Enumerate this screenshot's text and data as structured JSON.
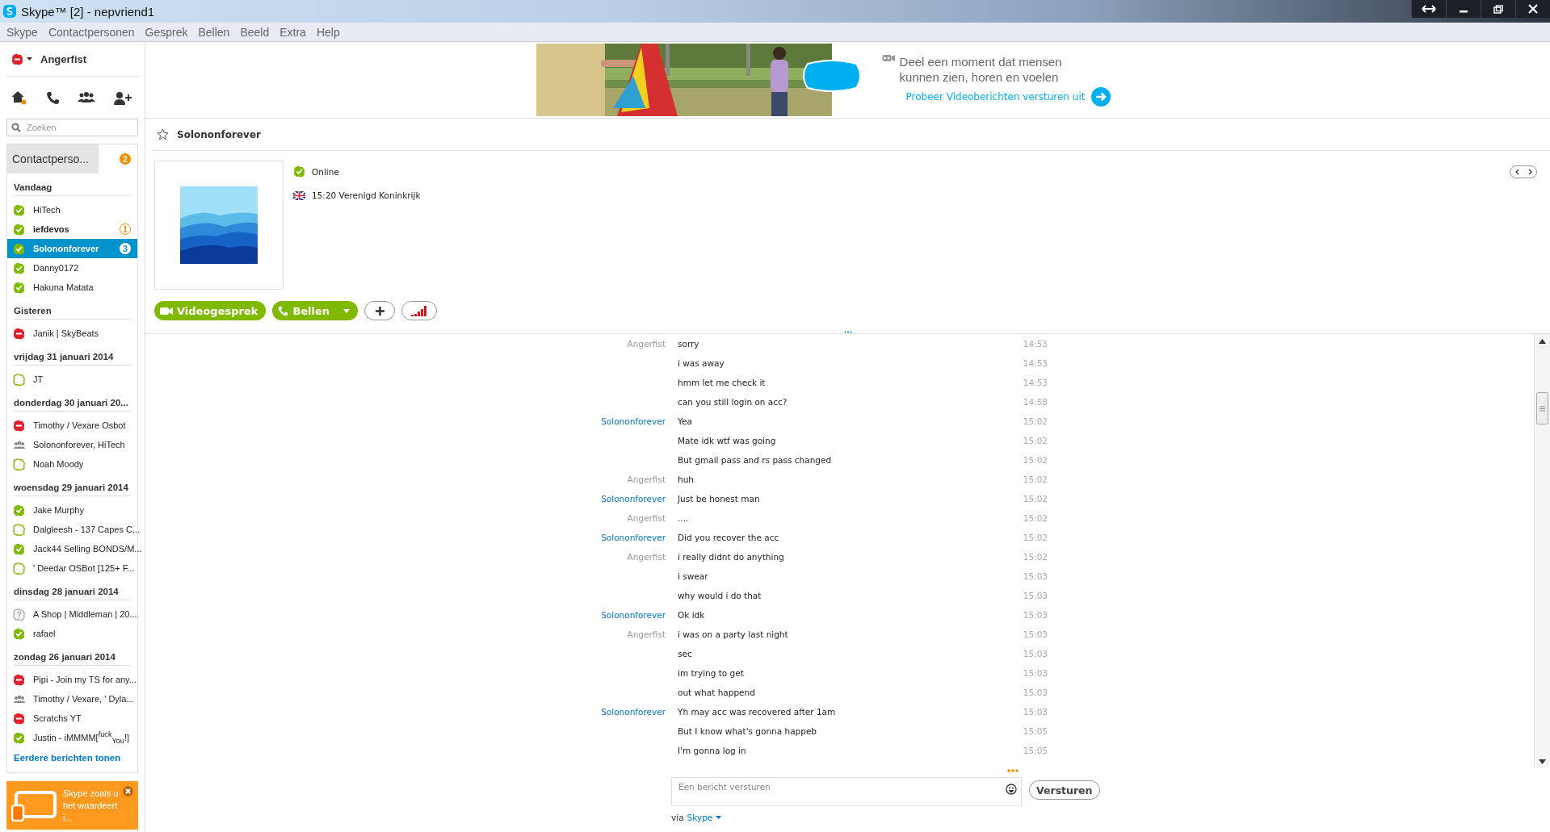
{
  "window": {
    "title": "Skype™ [2] - nepvriend1"
  },
  "menu": [
    "Skype",
    "Contactpersonen",
    "Gesprek",
    "Bellen",
    "Beeld",
    "Extra",
    "Help"
  ],
  "sidebar": {
    "user": {
      "name": "Angerfist",
      "kind": "busy"
    },
    "search": {
      "placeholder": "Zoeken"
    },
    "tab": {
      "label": "Contactperso...",
      "badge": "2"
    },
    "groups": [
      {
        "heading": "Vandaag",
        "contacts": [
          {
            "name": "HiTech",
            "kind": "online",
            "unread": false,
            "selected": false
          },
          {
            "name": "iefdevos",
            "kind": "online",
            "unread": true,
            "selected": false,
            "badge": "1"
          },
          {
            "name": "Solononforever",
            "kind": "online",
            "unread": false,
            "selected": true,
            "badge": "3"
          },
          {
            "name": "Danny0172",
            "kind": "online",
            "unread": false,
            "selected": false
          },
          {
            "name": "Hakuna Matata",
            "kind": "online",
            "unread": false,
            "selected": false
          }
        ]
      },
      {
        "heading": "Gisteren",
        "contacts": [
          {
            "name": "Janik | SkyBeats",
            "kind": "busy",
            "unread": false,
            "selected": false
          }
        ]
      },
      {
        "heading": "vrijdag 31 januari 2014",
        "contacts": [
          {
            "name": "JT",
            "kind": "offline",
            "unread": false,
            "selected": false
          }
        ]
      },
      {
        "heading": "donderdag 30 januari 20...",
        "contacts": [
          {
            "name": "Timothy / Vexare Osbot",
            "kind": "busy",
            "unread": false,
            "selected": false
          },
          {
            "name": "Solononforever, HiTech",
            "kind": "group",
            "unread": false,
            "selected": false
          },
          {
            "name": "Noah Moody",
            "kind": "offline",
            "unread": false,
            "selected": false
          }
        ]
      },
      {
        "heading": "woensdag 29 januari 2014",
        "contacts": [
          {
            "name": "Jake Murphy",
            "kind": "online",
            "unread": false,
            "selected": false
          },
          {
            "name": "Dalgleesh - 137 Capes C...",
            "kind": "offline",
            "unread": false,
            "selected": false
          },
          {
            "name": "Jack44 Selling BONDS/M...",
            "kind": "online",
            "unread": false,
            "selected": false
          },
          {
            "name": "' Deedar OSBot [125+ F...",
            "kind": "offline",
            "unread": false,
            "selected": false
          }
        ]
      },
      {
        "heading": "dinsdag 28 januari 2014",
        "contacts": [
          {
            "name": "A Shop | Middleman | 20...",
            "kind": "unknown",
            "unread": false,
            "selected": false
          },
          {
            "name": "rafael",
            "kind": "online",
            "unread": false,
            "selected": false
          }
        ]
      },
      {
        "heading": "zondag 26 januari 2014",
        "contacts": [
          {
            "name": "Pipi - Join my TS for any...",
            "kind": "busy",
            "unread": false,
            "selected": false
          },
          {
            "name": "Timothy / Vexare, ' Dyla...",
            "kind": "group",
            "unread": false,
            "selected": false
          },
          {
            "name": "Scratchs YT",
            "kind": "busy",
            "unread": false,
            "selected": false
          },
          {
            "name": "Justin - iMMMM[$^{fuck}$$_{You}$!]",
            "kind": "online",
            "unread": false,
            "selected": false
          }
        ]
      }
    ],
    "more_link": "Eerdere berichten tonen",
    "promo": {
      "text": "Skype zoals u het waardeert i..."
    }
  },
  "ad": {
    "headline": "Deel een moment dat mensen kunnen zien, horen en voelen",
    "link": "Probeer Videoberichten versturen uit"
  },
  "conversation": {
    "name": "Solononforever",
    "favorite": false,
    "status": {
      "label": "Online",
      "kind": "online"
    },
    "local_time": "15:20 Verenigd Koninkrijk",
    "buttons": {
      "video": "Videogesprek",
      "call": "Bellen"
    },
    "messages": [
      {
        "sender": "Angerfist",
        "self": true,
        "text": "sorry",
        "time": "14:53"
      },
      {
        "text": "i was away",
        "time": "14:53"
      },
      {
        "text": "hmm let me check it",
        "time": "14:53"
      },
      {
        "text": "can you still login on acc?",
        "time": "14:58"
      },
      {
        "sender": "Solononforever",
        "self": false,
        "text": "Yea",
        "time": "15:02"
      },
      {
        "text": "Mate idk wtf was going",
        "time": "15:02"
      },
      {
        "text": "But gmail pass and rs pass changed",
        "time": "15:02"
      },
      {
        "sender": "Angerfist",
        "self": true,
        "text": "huh",
        "time": "15:02"
      },
      {
        "sender": "Solononforever",
        "self": false,
        "text": "Just be honest man",
        "time": "15:02"
      },
      {
        "sender": "Angerfist",
        "self": true,
        "text": "....",
        "time": "15:02"
      },
      {
        "sender": "Solononforever",
        "self": false,
        "text": "Did you recover the acc",
        "time": "15:02"
      },
      {
        "sender": "Angerfist",
        "self": true,
        "text": "i really didnt do anything",
        "time": "15:02"
      },
      {
        "text": "i swear",
        "time": "15:03"
      },
      {
        "text": "why would i do that",
        "time": "15:03"
      },
      {
        "sender": "Solononforever",
        "self": false,
        "text": "Ok idk",
        "time": "15:03"
      },
      {
        "sender": "Angerfist",
        "self": true,
        "text": "i was on a party last night",
        "time": "15:03"
      },
      {
        "text": "sec",
        "time": "15:03"
      },
      {
        "text": "im trying to get",
        "time": "15:03"
      },
      {
        "text": "out what happend",
        "time": "15:03"
      },
      {
        "sender": "Solononforever",
        "self": false,
        "text": "Yh may acc was recovered after 1am",
        "time": "15:03"
      },
      {
        "text": "But I know what's gonna happeb",
        "time": "15:05"
      },
      {
        "text": "I'm gonna log in",
        "time": "15:05"
      }
    ],
    "compose": {
      "placeholder": "Een bericht versturen",
      "send": "Versturen",
      "via_label": "via",
      "via_service": "Skype"
    }
  }
}
